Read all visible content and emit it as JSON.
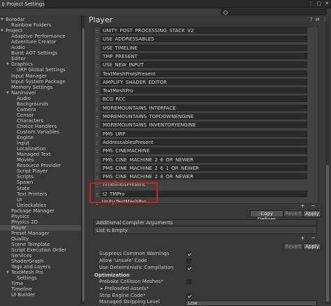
{
  "window": {
    "tab_title": "Project Settings",
    "controls": [
      "⋮",
      "□",
      "✕"
    ]
  },
  "search": {
    "placeholder": ""
  },
  "sidebar": [
    {
      "label": "Borodar",
      "level": 0,
      "arrow": "▼"
    },
    {
      "label": "Rainbow Folders",
      "level": 1
    },
    {
      "label": "Project",
      "level": 0,
      "arrow": "▼"
    },
    {
      "label": "Adaptive Performance",
      "level": 1
    },
    {
      "label": "Adventure Creator",
      "level": 1
    },
    {
      "label": "Audio",
      "level": 1
    },
    {
      "label": "Burst AOT Settings",
      "level": 1
    },
    {
      "label": "Editor",
      "level": 1
    },
    {
      "label": "Graphics",
      "level": 1,
      "arrow": "▼"
    },
    {
      "label": "URP Global Settings",
      "level": 2
    },
    {
      "label": "Input Manager",
      "level": 1
    },
    {
      "label": "Input System Package",
      "level": 1
    },
    {
      "label": "Memory Settings",
      "level": 1
    },
    {
      "label": "Naninovel",
      "level": 1,
      "arrow": "▼"
    },
    {
      "label": "Audio",
      "level": 2
    },
    {
      "label": "Backgrounds",
      "level": 2
    },
    {
      "label": "Camera",
      "level": 2
    },
    {
      "label": "Censor",
      "level": 2
    },
    {
      "label": "Characters",
      "level": 2
    },
    {
      "label": "Choice Handlers",
      "level": 2
    },
    {
      "label": "Custom Variables",
      "level": 2
    },
    {
      "label": "Engine",
      "level": 2
    },
    {
      "label": "Input",
      "level": 2
    },
    {
      "label": "Localization",
      "level": 2
    },
    {
      "label": "Managed Text",
      "level": 2
    },
    {
      "label": "Movies",
      "level": 2
    },
    {
      "label": "Resource Provider",
      "level": 2
    },
    {
      "label": "Script Player",
      "level": 2
    },
    {
      "label": "Scripts",
      "level": 2
    },
    {
      "label": "Spawn",
      "level": 2
    },
    {
      "label": "State",
      "level": 2
    },
    {
      "label": "Text Printers",
      "level": 2
    },
    {
      "label": "UI",
      "level": 2
    },
    {
      "label": "Unlockables",
      "level": 2
    },
    {
      "label": "Package Manager",
      "level": 1
    },
    {
      "label": "Physics",
      "level": 1
    },
    {
      "label": "Physics 2D",
      "level": 1
    },
    {
      "label": "Player",
      "level": 1,
      "selected": true
    },
    {
      "label": "Preset Manager",
      "level": 1
    },
    {
      "label": "Quality",
      "level": 1
    },
    {
      "label": "Scene Template",
      "level": 1
    },
    {
      "label": "Script Execution Order",
      "level": 1
    },
    {
      "label": "Services",
      "level": 1
    },
    {
      "label": "ShaderGraph",
      "level": 1
    },
    {
      "label": "Tags and Layers",
      "level": 1
    },
    {
      "label": "TextMesh Pro",
      "level": 1,
      "arrow": "▼"
    },
    {
      "label": "Settings",
      "level": 2
    },
    {
      "label": "Time",
      "level": 1
    },
    {
      "label": "Timeline",
      "level": 1
    },
    {
      "label": "UI Builder",
      "level": 1
    }
  ],
  "main": {
    "title": "Player",
    "header_icons": [
      "?",
      "⇄",
      "⋮"
    ],
    "symbols": [
      {
        "text": "UNITY_POST_PROCESSING_STACK_V2",
        "field": true
      },
      {
        "text": "USE_ADDRESSABLES",
        "field": true
      },
      {
        "text": "USE_TIMELINE",
        "field": true
      },
      {
        "text": "TMP_PRESENT",
        "field": true
      },
      {
        "text": "USE_NEW_INPUT",
        "field": true
      },
      {
        "text": "TextMeshProIsPresent",
        "field": true
      },
      {
        "text": "AMPLIFY_SHADER_EDITOR",
        "field": true
      },
      {
        "text": "TextMeshPro",
        "field": true
      },
      {
        "text": "BCG_RCC",
        "field": true
      },
      {
        "text": "MOREMOUNTAINS_INTERFACE",
        "field": true
      },
      {
        "text": "MOREMOUNTAINS_TOPDOWNENGINE",
        "field": true
      },
      {
        "text": "MOREMOUNTAINS_INVENTORYENGINE",
        "field": true
      },
      {
        "text": "PMS_URP",
        "field": true
      },
      {
        "text": "AddressablesPresent",
        "field": true
      },
      {
        "text": "PMS_CINEMACHINE",
        "field": true
      },
      {
        "text": "PMS_CINE_MACHINE_2_6_OR_NEWER",
        "field": true
      },
      {
        "text": "PMS_CINE_MACHINE_2_6_1_OR_NEWER",
        "field": true
      },
      {
        "text": "PMS_CINE_MACHINE_2_8_OR_NEWER",
        "field": true
      },
      {
        "text": "TimelineIsPresent",
        "field": false
      },
      {
        "text": "I2_TMPro",
        "field": true
      },
      {
        "text": "Unity.TextMeshPro",
        "field": false
      }
    ],
    "list_buttons": {
      "add": "+",
      "remove": "−"
    },
    "actions": {
      "copy": "Copy Defines",
      "revert": "Revert",
      "apply": "Apply"
    },
    "compiler_section": {
      "title": "Additional Compiler Arguments",
      "empty": "List is Empty"
    },
    "compiler_actions": {
      "revert": "Revert",
      "apply": "Apply"
    },
    "options": [
      {
        "label": "Suppress Common Warnings",
        "checked": true
      },
      {
        "label": "Allow 'unsafe' Code",
        "checked": false
      },
      {
        "label": "Use Deterministic Compilation",
        "checked": true
      }
    ],
    "optimization": {
      "heading": "Optimization",
      "prebake": {
        "label": "Prebake Collision Meshes*",
        "checked": false
      },
      "preloaded": "Preloaded Assets*",
      "strip": {
        "label": "Strip Engine Code*",
        "checked": true
      },
      "managed": {
        "label": "Managed Stripping Level",
        "value": "Low"
      }
    }
  }
}
